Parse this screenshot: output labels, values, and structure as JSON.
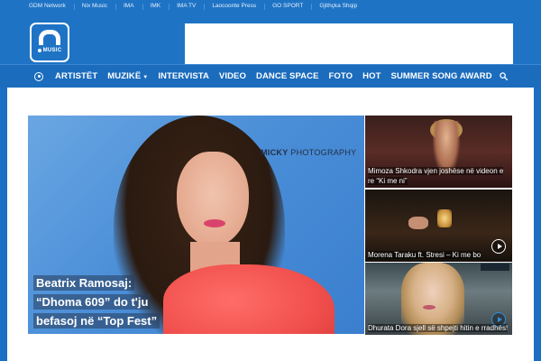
{
  "topbar": {
    "links": [
      "GDM Network",
      "Nix Music",
      "IMA",
      "IMK",
      "IMA TV",
      "Laocoonte Press",
      "GO SPORT",
      "Gjithçka Shqip"
    ]
  },
  "logo": {
    "text": "MUSIC"
  },
  "nav": {
    "items": [
      "ARTISTËT",
      "MUZIKË",
      "INTERVISTA",
      "VIDEO",
      "DANCE SPACE",
      "FOTO",
      "HOT",
      "SUMMER SONG AWARD"
    ]
  },
  "hero": {
    "watermark_bold": "MICKY",
    "watermark_rest": " PHOTOGRAPHY",
    "caption": "Beatrix Ramosaj: “Dhoma 609” do t'ju befasoj në “Top Fest”"
  },
  "thumbs": [
    {
      "caption": "Mimoza Shkodra vjen joshëse në videon e re “Ki me ni”"
    },
    {
      "caption": "Morena Taraku ft. Stresi – Ki me bo"
    },
    {
      "caption": "Dhurata Dora sjell së shpejti hitin e rradhës!"
    }
  ],
  "colors": {
    "brand_blue": "#1e73c5",
    "nav_blue": "#1b6cbd",
    "accent_play": "#2d8fe0"
  }
}
